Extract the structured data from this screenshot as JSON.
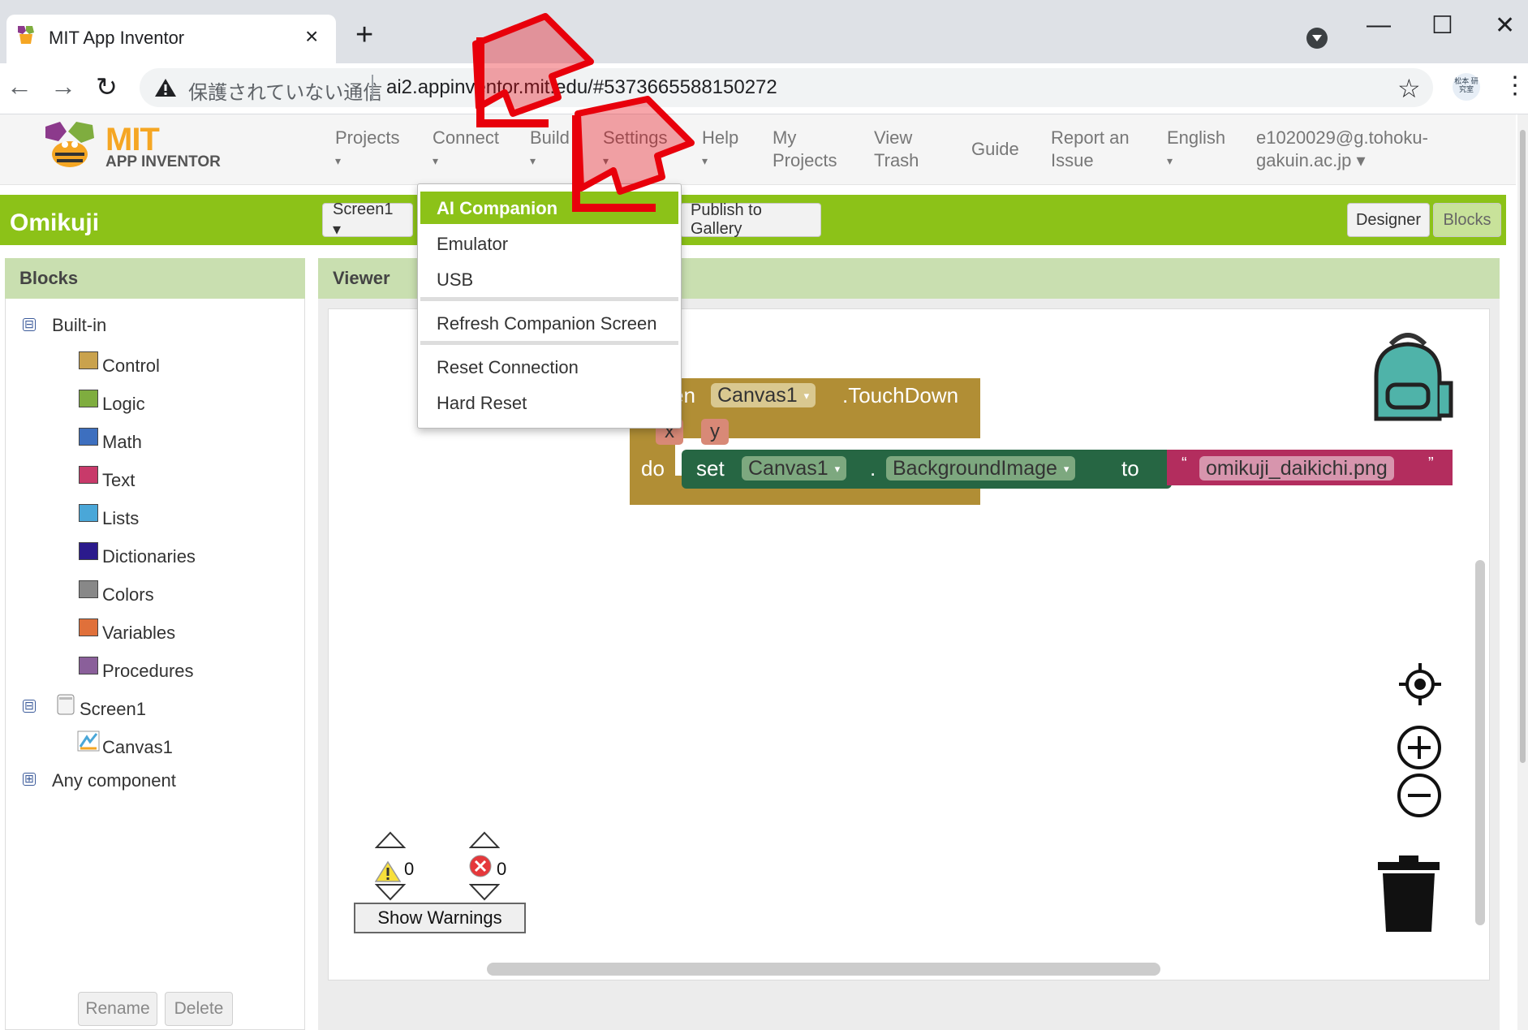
{
  "browser": {
    "tab_title": "MIT App Inventor",
    "tab_close": "×",
    "new_tab": "+",
    "minimize": "—",
    "maximize": "☐",
    "close": "✕",
    "back": "←",
    "forward": "→",
    "reload": "↻",
    "security_label": "保護されていない通信",
    "url": "ai2.appinventor.mit.edu/#5373665588150272",
    "bookmark": "☆",
    "menu": "⋮",
    "profile_text": "松本 研究室"
  },
  "header": {
    "logo_mit": "MIT",
    "logo_sub": "APP INVENTOR",
    "menus": [
      {
        "label": "Projects"
      },
      {
        "label": "Connect"
      },
      {
        "label": "Build"
      },
      {
        "label": "Settings"
      },
      {
        "label": "Help"
      },
      {
        "label": "My\nProjects"
      },
      {
        "label": "View\nTrash"
      },
      {
        "label": "Guide"
      },
      {
        "label": "Report an\nIssue"
      },
      {
        "label": "English"
      },
      {
        "label": "e1020029@g.tohoku-\ngakuin.ac.jp ▾"
      }
    ],
    "caret": "▾"
  },
  "project_bar": {
    "project_name": "Omikuji",
    "screen_select": "Screen1 ▾",
    "publish_button": "Publish to Gallery",
    "designer_button": "Designer",
    "blocks_button": "Blocks"
  },
  "connect_menu": {
    "items": [
      "AI Companion",
      "Emulator",
      "USB",
      "Refresh Companion Screen",
      "Reset Connection",
      "Hard Reset"
    ]
  },
  "blocks_panel": {
    "title": "Blocks",
    "builtin_label": "Built-in",
    "categories": [
      {
        "label": "Control",
        "color": "#c9a24d"
      },
      {
        "label": "Logic",
        "color": "#7fad3f"
      },
      {
        "label": "Math",
        "color": "#3d6fbf"
      },
      {
        "label": "Text",
        "color": "#c83a6a"
      },
      {
        "label": "Lists",
        "color": "#4aa7d8"
      },
      {
        "label": "Dictionaries",
        "color": "#2b1a8c"
      },
      {
        "label": "Colors",
        "color": "#888888"
      },
      {
        "label": "Variables",
        "color": "#e0703a"
      },
      {
        "label": "Procedures",
        "color": "#8a5f9a"
      }
    ],
    "screen_label": "Screen1",
    "canvas_label": "Canvas1",
    "any_component_label": "Any component",
    "rename_button": "Rename",
    "delete_button": "Delete",
    "toggle_minus": "⊟",
    "toggle_plus": "⊞"
  },
  "viewer": {
    "title": "Viewer",
    "event_block": {
      "prefix": "en",
      "component": "Canvas1",
      "event": ".TouchDown",
      "param_x": "x",
      "param_y": "y",
      "do_label": "do"
    },
    "set_block": {
      "set_label": "set",
      "component": "Canvas1",
      "dot": ".",
      "property": "BackgroundImage",
      "to_label": "to"
    },
    "text_block": {
      "open_quote": "“",
      "value": "omikuji_daikichi.png",
      "close_quote": "”"
    },
    "warnings_count": "0",
    "errors_count": "0",
    "show_warnings_button": "Show Warnings"
  },
  "colors": {
    "brand_green": "#8cc218",
    "event_block": "#b18e35",
    "set_block": "#266643",
    "text_block": "#b32d5e",
    "arrow_red": "#e8000b"
  }
}
